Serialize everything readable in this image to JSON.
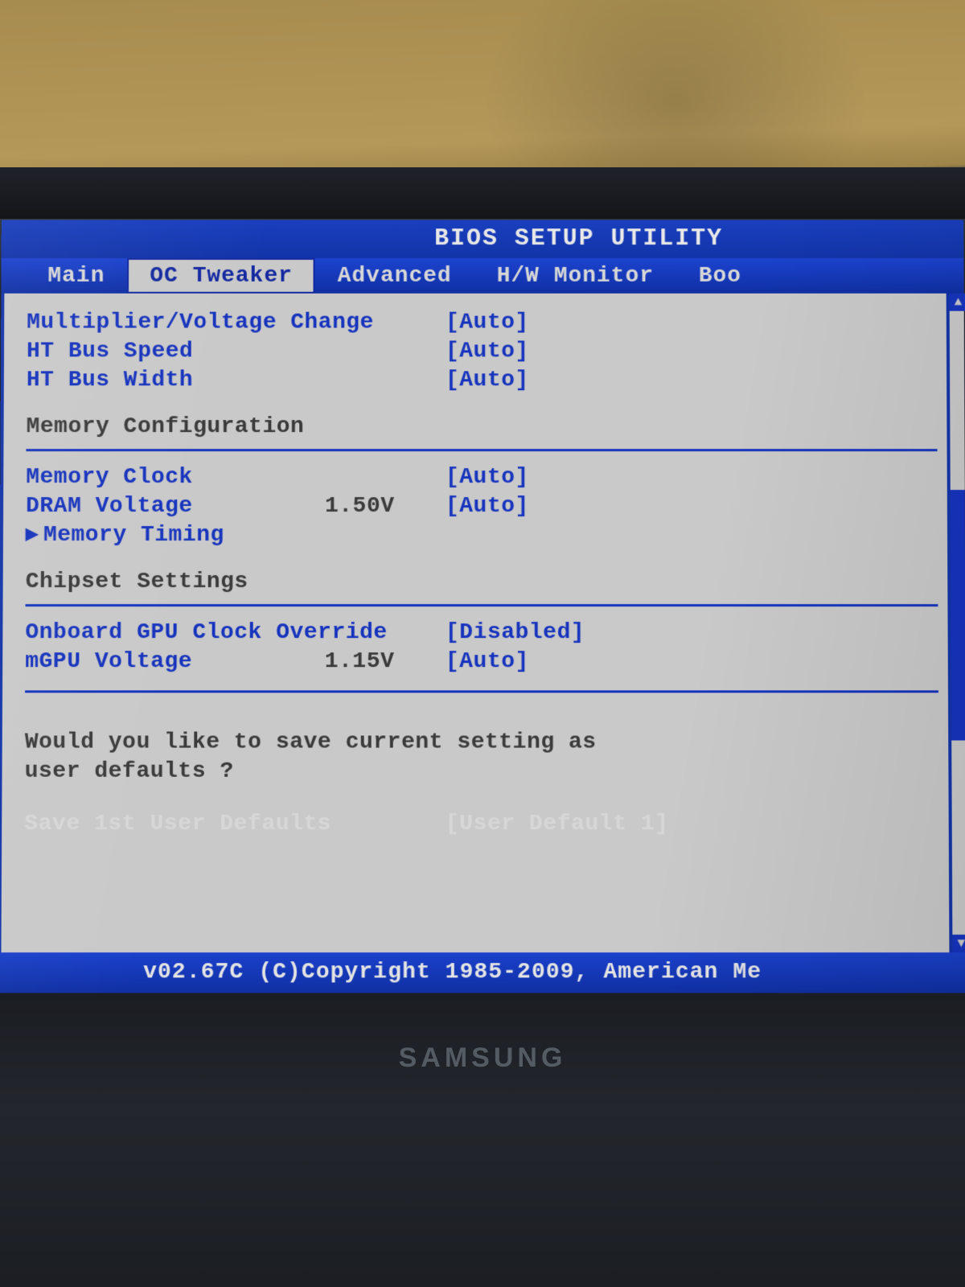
{
  "header": {
    "title": "BIOS SETUP UTILITY"
  },
  "menu": {
    "items": [
      "Main",
      "OC Tweaker",
      "Advanced",
      "H/W Monitor",
      "Boo"
    ],
    "active_index": 1
  },
  "settings": {
    "multiplier_voltage": {
      "label": "Multiplier/Voltage Change",
      "value": "[Auto]"
    },
    "ht_speed": {
      "label": "HT Bus Speed",
      "value": "[Auto]"
    },
    "ht_width": {
      "label": "HT Bus Width",
      "value": "[Auto]"
    },
    "section_mem": {
      "heading": "Memory Configuration"
    },
    "mem_clock": {
      "label": "Memory Clock",
      "value": "[Auto]"
    },
    "dram_v": {
      "label": "DRAM Voltage",
      "mid": "1.50V",
      "value": "[Auto]"
    },
    "mem_timing": {
      "label": "Memory Timing"
    },
    "section_chip": {
      "heading": "Chipset Settings"
    },
    "gpu_override": {
      "label": "Onboard GPU Clock Override",
      "value": "[Disabled]"
    },
    "mgpu_v": {
      "label": "mGPU Voltage",
      "mid": "1.15V",
      "value": "[Auto]"
    },
    "prompt_l1": "Would you like to save current setting as",
    "prompt_l2": "user defaults ?",
    "save_row": {
      "label": "Save 1st User Defaults",
      "value": "[User Default  1]"
    }
  },
  "footer": {
    "text": "v02.67C (C)Copyright 1985-2009, American Me"
  },
  "monitor": {
    "brand": "SAMSUNG"
  }
}
